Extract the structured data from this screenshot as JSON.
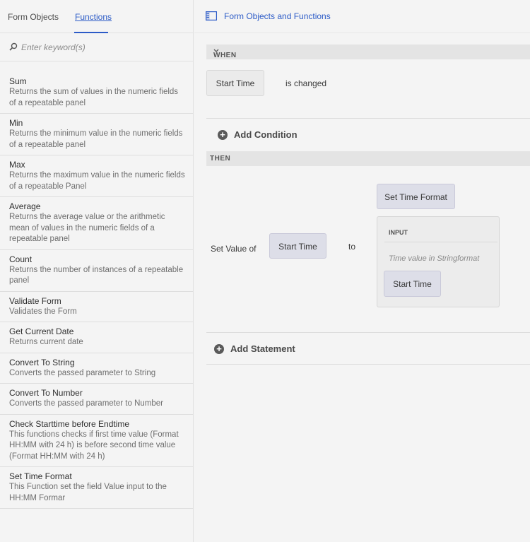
{
  "tabs": [
    {
      "label": "Form Objects"
    },
    {
      "label": "Functions"
    }
  ],
  "search": {
    "placeholder": "Enter keyword(s)"
  },
  "functions": [
    {
      "name": "Sum",
      "desc": "Returns the sum of values in the numeric fields of a repeatable panel"
    },
    {
      "name": "Min",
      "desc": "Returns the minimum value in the numeric fields of a repeatable panel"
    },
    {
      "name": "Max",
      "desc": "Returns the maximum value in the numeric fields of a repeatable Panel"
    },
    {
      "name": "Average",
      "desc": "Returns the average value or the arithmetic mean of values in the numeric fields of a repeatable panel"
    },
    {
      "name": "Count",
      "desc": "Returns the number of instances of a repeatable panel"
    },
    {
      "name": "Validate Form",
      "desc": "Validates the Form"
    },
    {
      "name": "Get Current Date",
      "desc": "Returns current date"
    },
    {
      "name": "Convert To String",
      "desc": "Converts the passed parameter to String"
    },
    {
      "name": "Convert To Number",
      "desc": "Converts the passed parameter to Number"
    },
    {
      "name": "Check Starttime before Endtime",
      "desc": "This functions checks if first time value (Format HH:MM with 24 h) is before second time value (Format HH:MM with 24 h)"
    },
    {
      "name": "Set Time Format",
      "desc": "This Function set the field Value input to the HH:MM Formar"
    }
  ],
  "editor": {
    "header_title": "Form Objects and Functions",
    "when_label": "WHEN",
    "when_object": "Start Time",
    "when_event": "is changed",
    "add_condition": "Add Condition",
    "then_label": "THEN",
    "set_value_of": "Set Value of",
    "target_object": "Start Time",
    "to_label": "to",
    "function_name": "Set Time Format",
    "input_label": "INPUT",
    "input_hint": "Time value in Stringformat",
    "input_object": "Start Time",
    "add_statement": "Add Statement"
  }
}
